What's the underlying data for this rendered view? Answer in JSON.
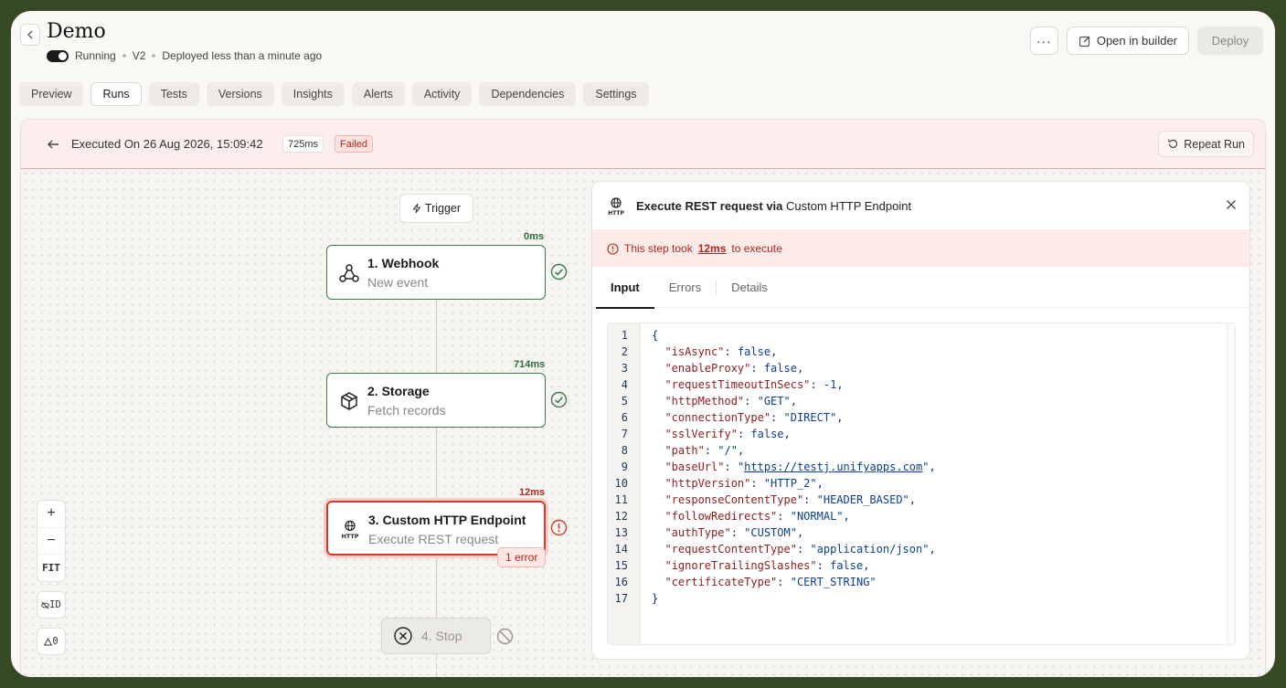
{
  "header": {
    "title": "Demo",
    "status": "Running",
    "version": "V2",
    "deployed": "Deployed less than a minute ago",
    "more_label": "···",
    "open_builder_label": "Open in builder",
    "deploy_label": "Deploy"
  },
  "tabs": [
    "Preview",
    "Runs",
    "Tests",
    "Versions",
    "Insights",
    "Alerts",
    "Activity",
    "Dependencies",
    "Settings"
  ],
  "active_tab": "Runs",
  "run": {
    "title": "Executed On 26 Aug 2026, 15:09:42",
    "duration": "725ms",
    "status": "Failed",
    "repeat_label": "Repeat Run"
  },
  "flow": {
    "trigger_label": "Trigger",
    "steps": [
      {
        "ms": "0ms",
        "title": "1. Webhook",
        "subtitle": "New event",
        "state": "success"
      },
      {
        "ms": "714ms",
        "title": "2. Storage",
        "subtitle": "Fetch records",
        "state": "success"
      },
      {
        "ms": "12ms",
        "title": "3. Custom HTTP Endpoint",
        "subtitle": "Execute REST request",
        "state": "error",
        "error_count": "1 error"
      }
    ],
    "stop_label": "4. Stop",
    "zoom_in": "+",
    "zoom_out": "−",
    "fit_label": "FIT",
    "id_label": "ID",
    "warn_count": "0"
  },
  "panel": {
    "title_prefix": "Execute REST request via",
    "title_name": "Custom HTTP Endpoint",
    "warning_prefix": "This step took",
    "warning_value": "12ms",
    "warning_suffix": "to execute",
    "tabs": [
      "Input",
      "Errors",
      "Details"
    ],
    "active_tab": "Input",
    "code_lines": [
      [
        "{",
        null,
        null
      ],
      [
        "  ",
        "\"isAsync\"",
        ": false,"
      ],
      [
        "  ",
        "\"enableProxy\"",
        ": false,"
      ],
      [
        "  ",
        "\"requestTimeoutInSecs\"",
        ": -1,"
      ],
      [
        "  ",
        "\"httpMethod\"",
        ": \"GET\","
      ],
      [
        "  ",
        "\"connectionType\"",
        ": \"DIRECT\","
      ],
      [
        "  ",
        "\"sslVerify\"",
        ": false,"
      ],
      [
        "  ",
        "\"path\"",
        ": \"/\","
      ],
      [
        "  ",
        "\"baseUrl\"",
        ": \"https://testj.unifyapps.com\","
      ],
      [
        "  ",
        "\"httpVersion\"",
        ": \"HTTP_2\","
      ],
      [
        "  ",
        "\"responseContentType\"",
        ": \"HEADER_BASED\","
      ],
      [
        "  ",
        "\"followRedirects\"",
        ": \"NORMAL\","
      ],
      [
        "  ",
        "\"authType\"",
        ": \"CUSTOM\","
      ],
      [
        "  ",
        "\"requestContentType\"",
        ": \"application/json\","
      ],
      [
        "  ",
        "\"ignoreTrailingSlashes\"",
        ": false,"
      ],
      [
        "  ",
        "\"certificateType\"",
        ": \"CERT_STRING\""
      ],
      [
        "}",
        null,
        null
      ]
    ]
  },
  "colors": {
    "success": "#3d7a48",
    "error": "#d33a2f",
    "background": "#354a24"
  }
}
